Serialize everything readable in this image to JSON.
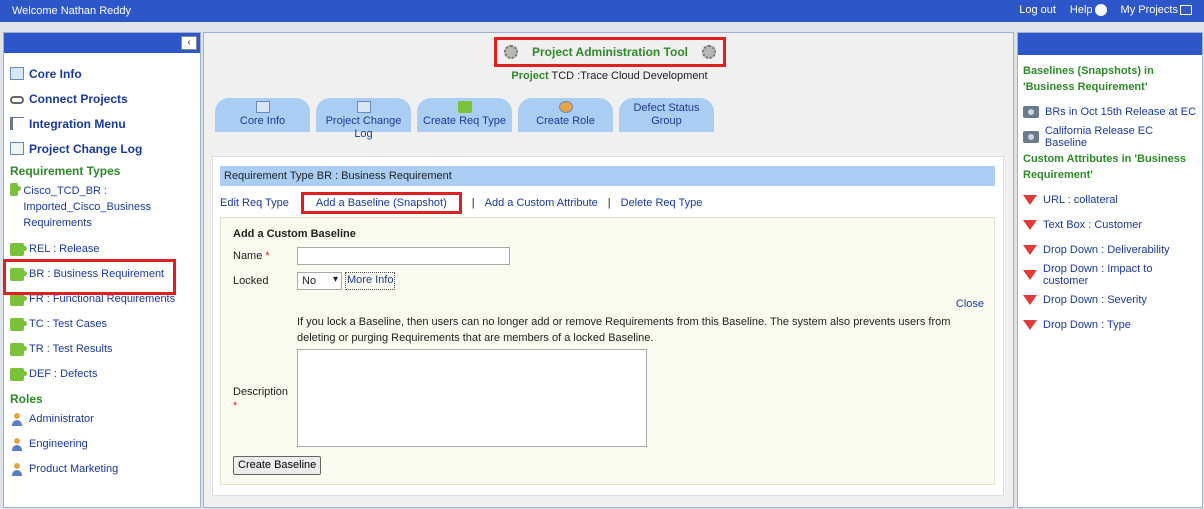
{
  "topbar": {
    "welcome": "Welcome Nathan Reddy",
    "logout": "Log out",
    "help": "Help",
    "projects": "My Projects"
  },
  "left": {
    "nav": [
      {
        "label": "Core Info",
        "icon": "core-info-icon"
      },
      {
        "label": "Connect Projects",
        "icon": "link-icon"
      },
      {
        "label": "Integration Menu",
        "icon": "menu-icon"
      },
      {
        "label": "Project Change Log",
        "icon": "log-icon"
      }
    ],
    "req_types_title": "Requirement Types",
    "req_types": [
      {
        "label": "Cisco_TCD_BR : Imported_Cisco_Business Requirements"
      },
      {
        "label": "REL : Release"
      },
      {
        "label": "BR : Business Requirement"
      },
      {
        "label": "FR : Functional Requirements"
      },
      {
        "label": "TC : Test Cases"
      },
      {
        "label": "TR : Test Results"
      },
      {
        "label": "DEF : Defects"
      }
    ],
    "roles_title": "Roles",
    "roles": [
      {
        "label": "Administrator"
      },
      {
        "label": "Engineering"
      },
      {
        "label": "Product Marketing"
      }
    ]
  },
  "center": {
    "title": "Project Administration Tool",
    "project_label": "Project",
    "project_value": "TCD :Trace Cloud Development",
    "tabs": [
      {
        "label": "Core Info"
      },
      {
        "label": "Project Change Log"
      },
      {
        "label": "Create Req Type"
      },
      {
        "label": "Create Role"
      },
      {
        "label": "Defect Status Group"
      }
    ],
    "rt_header": "Requirement Type BR : Business Requirement",
    "actions": {
      "edit": "Edit Req Type",
      "add_baseline": "Add a Baseline (Snapshot)",
      "add_attr": "Add a Custom Attribute",
      "delete": "Delete Req Type"
    },
    "form": {
      "title": "Add a Custom Baseline",
      "name_label": "Name",
      "locked_label": "Locked",
      "locked_value": "No",
      "more_info": "More Info",
      "close": "Close",
      "lock_text": "If you lock a Baseline, then users can no longer add or remove Requirements from this Baseline. The system also prevents users from deleting or purging Requirements that are members of a locked Baseline.",
      "description_label": "Description",
      "required_mark": "*",
      "create_button": "Create Baseline"
    }
  },
  "right": {
    "baselines_title": "Baselines (Snapshots) in 'Business Requirement'",
    "baselines": [
      {
        "label": "BRs in Oct 15th Release at EC"
      },
      {
        "label": "California Release EC Baseline"
      }
    ],
    "attrs_title": "Custom Attributes in 'Business Requirement'",
    "attrs": [
      {
        "label": "URL : collateral"
      },
      {
        "label": "Text Box : Customer"
      },
      {
        "label": "Drop Down : Deliverability"
      },
      {
        "label": "Drop Down : Impact to customer"
      },
      {
        "label": "Drop Down : Severity"
      },
      {
        "label": "Drop Down : Type"
      }
    ]
  },
  "colors": {
    "header_blue": "#2d56c9",
    "tab_blue": "#a9cdf3",
    "section_green": "#2e8b27",
    "highlight_red": "#e02020"
  }
}
